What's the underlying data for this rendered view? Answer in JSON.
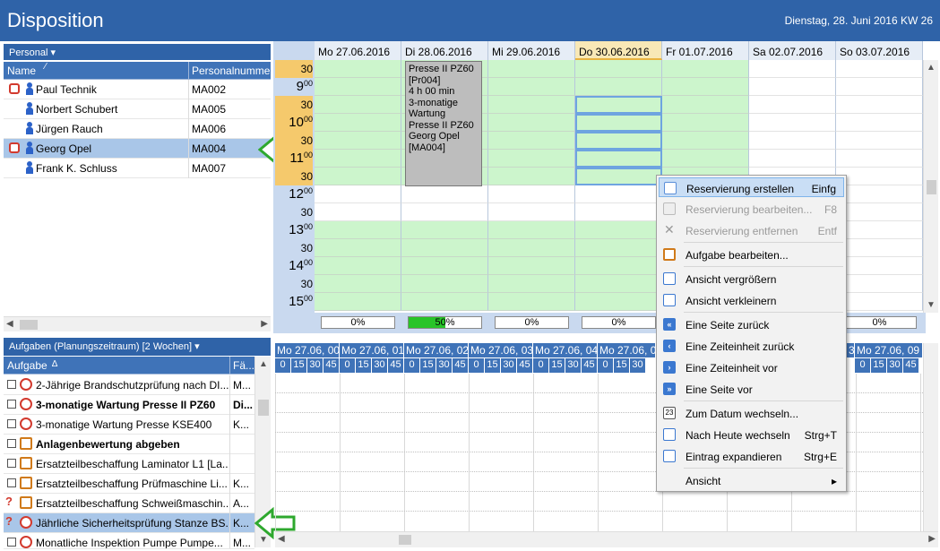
{
  "title": "Disposition",
  "date_header": "Dienstag, 28. Juni 2016  KW 26",
  "personal": {
    "dropdown_label": "Personal ▾",
    "col_name": "Name",
    "col_sort": "⁄",
    "col_num": "Personalnumme",
    "rows": [
      {
        "name": "Paul Technik",
        "num": "MA002"
      },
      {
        "name": "Norbert Schubert",
        "num": "MA005"
      },
      {
        "name": "Jürgen Rauch",
        "num": "MA006"
      },
      {
        "name": "Georg Opel",
        "num": "MA004"
      },
      {
        "name": "Frank K. Schluss",
        "num": "MA007"
      }
    ]
  },
  "calendar": {
    "days": [
      "Mo 27.06.2016",
      "Di 28.06.2016",
      "Mi 29.06.2016",
      "Do 30.06.2016",
      "Fr 01.07.2016",
      "Sa 02.07.2016",
      "So 03.07.2016"
    ],
    "time_labels": {
      "t1": "30",
      "t2": "9",
      "t3": "30",
      "t4": "10",
      "t5": "30",
      "t6": "11",
      "t7": "30",
      "t8": "12",
      "t9": "30",
      "t10": "13",
      "t11": "30",
      "t12": "14",
      "t13": "30",
      "t14": "15",
      "minutes": "00"
    },
    "appointment": "Presse II PZ60\n[Pr004]\n4 h 00 min\n3-monatige\nWartung\nPresse II PZ60\nGeorg Opel\n[MA004]",
    "percentages": [
      "0%",
      "50%",
      "0%",
      "0%",
      "0%"
    ],
    "progress_fill": 0.5
  },
  "tasks": {
    "dropdown_label": "Aufgaben (Planungszeitraum) [2 Wochen] ▾",
    "col_task": "Aufgabe",
    "col_sort": "∆",
    "col_fa": "Fä...",
    "rows": [
      {
        "name": "2-Jährige Brandschutzprüfung nach DI...",
        "fa": "M..."
      },
      {
        "name": "3-monatige Wartung Presse II PZ60",
        "fa": "Di..."
      },
      {
        "name": "3-monatige Wartung Presse KSE400",
        "fa": "K..."
      },
      {
        "name": "Anlagenbewertung abgeben",
        "fa": ""
      },
      {
        "name": "Ersatzteilbeschaffung Laminator L1 [La...",
        "fa": ""
      },
      {
        "name": "Ersatzteilbeschaffung Prüfmaschine Li...",
        "fa": "K..."
      },
      {
        "name": "Ersatzteilbeschaffung Schweißmaschin...",
        "fa": "A..."
      },
      {
        "name": "Jährliche Sicherheitsprüfung Stanze BS...",
        "fa": "K..."
      },
      {
        "name": "Monatliche Inspektion Pumpe Pumpe...",
        "fa": "M..."
      }
    ]
  },
  "timeline": {
    "heads": [
      "Mo 27.06, 00",
      "Mo 27.06, 01",
      "Mo 27.06, 02",
      "Mo 27.06, 03",
      "Mo 27.06, 04",
      "Mo 27.06, 05",
      "Mo 27.06, 09"
    ],
    "partial": "3",
    "minutes": [
      "0",
      "15",
      "30",
      "45"
    ]
  },
  "menu": {
    "items": [
      {
        "label": "Reservierung erstellen",
        "key": "Einfg"
      },
      {
        "label": "Reservierung bearbeiten...",
        "key": "F8"
      },
      {
        "label": "Reservierung entfernen",
        "key": "Entf"
      },
      {
        "label": "Aufgabe bearbeiten...",
        "key": ""
      },
      {
        "label": "Ansicht vergrößern",
        "key": ""
      },
      {
        "label": "Ansicht verkleinern",
        "key": ""
      },
      {
        "label": "Eine Seite zurück",
        "key": ""
      },
      {
        "label": "Eine Zeiteinheit zurück",
        "key": ""
      },
      {
        "label": "Eine Zeiteinheit vor",
        "key": ""
      },
      {
        "label": "Eine Seite vor",
        "key": ""
      },
      {
        "label": "Zum Datum wechseln...",
        "key": ""
      },
      {
        "label": "Nach Heute wechseln",
        "key": "Strg+T"
      },
      {
        "label": "Eintrag expandieren",
        "key": "Strg+E"
      },
      {
        "label": "Ansicht",
        "key": "▸"
      }
    ],
    "calendar_icon_text": "23"
  },
  "colors": {
    "accent": "#2f63a8",
    "free_slot": "#ccf5cc",
    "today": "#f8e8b6",
    "arrow": "#2ea82e"
  }
}
